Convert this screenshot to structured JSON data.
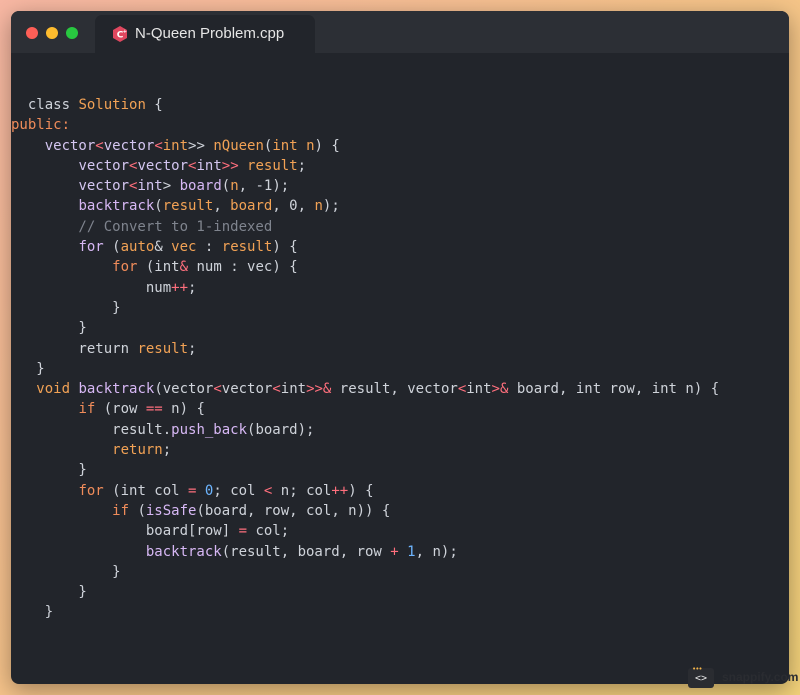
{
  "window": {
    "title": "N-Queen Problem.cpp",
    "language_icon": "cpp-icon"
  },
  "colors": {
    "background_gradient": [
      "#f7b7a3",
      "#f5c28a",
      "#f3d27a"
    ],
    "editor_bg": "#22252b",
    "titlebar_bg": "#2c2f35",
    "keyword": "#f08c5a",
    "function": "#d7b8f5",
    "operator": "#ff6f7d",
    "number": "#6db5ff",
    "comment": "#7f848e"
  },
  "code": {
    "lines": [
      [
        [
          "  class ",
          "plain"
        ],
        [
          "Solution",
          "var"
        ],
        [
          " {",
          "punct"
        ]
      ],
      [
        [
          "public:",
          "kw"
        ]
      ],
      [
        [
          "    ",
          "plain"
        ],
        [
          "vector",
          "type"
        ],
        [
          "<",
          "op"
        ],
        [
          "vector",
          "type"
        ],
        [
          "<",
          "op"
        ],
        [
          "int",
          "var"
        ],
        [
          ">> ",
          "plain"
        ],
        [
          "nQueen",
          "var"
        ],
        [
          "(",
          "punct"
        ],
        [
          "int",
          "var"
        ],
        [
          " n",
          "var"
        ],
        [
          ") {",
          "punct"
        ]
      ],
      [
        [
          "        ",
          "plain"
        ],
        [
          "vector",
          "type"
        ],
        [
          "<",
          "op"
        ],
        [
          "vector",
          "type"
        ],
        [
          "<",
          "op"
        ],
        [
          "int",
          "type"
        ],
        [
          ">>",
          "op"
        ],
        [
          " result",
          "var"
        ],
        [
          ";",
          "punct"
        ]
      ],
      [
        [
          "        ",
          "plain"
        ],
        [
          "vector",
          "type"
        ],
        [
          "<",
          "op"
        ],
        [
          "int",
          "type"
        ],
        [
          "> ",
          "plain"
        ],
        [
          "board",
          "fn"
        ],
        [
          "(",
          "punct"
        ],
        [
          "n",
          "var"
        ],
        [
          ", -1);",
          "punct"
        ]
      ],
      [
        [
          "        ",
          "plain"
        ],
        [
          "backtrack",
          "fn"
        ],
        [
          "(",
          "punct"
        ],
        [
          "result",
          "var"
        ],
        [
          ", ",
          "punct"
        ],
        [
          "board",
          "var"
        ],
        [
          ", 0, ",
          "punct"
        ],
        [
          "n",
          "var"
        ],
        [
          ");",
          "punct"
        ]
      ],
      [
        [
          "        // Convert to 1-indexed",
          "comment"
        ]
      ],
      [
        [
          "        ",
          "plain"
        ],
        [
          "for",
          "fn"
        ],
        [
          " (",
          "punct"
        ],
        [
          "auto",
          "var"
        ],
        [
          "& ",
          "plain"
        ],
        [
          "vec",
          "var"
        ],
        [
          " : ",
          "plain"
        ],
        [
          "result",
          "var"
        ],
        [
          ") {",
          "punct"
        ]
      ],
      [
        [
          "            ",
          "plain"
        ],
        [
          "for",
          "kw"
        ],
        [
          " (int",
          "plain"
        ],
        [
          "&",
          "op"
        ],
        [
          " num : vec) {",
          "plain"
        ]
      ],
      [
        [
          "                num",
          "plain"
        ],
        [
          "++",
          "op"
        ],
        [
          ";",
          "punct"
        ]
      ],
      [
        [
          "            }",
          "punct"
        ]
      ],
      [
        [
          "        }",
          "punct"
        ]
      ],
      [
        [
          "        return ",
          "plain"
        ],
        [
          "result",
          "var"
        ],
        [
          ";",
          "punct"
        ]
      ],
      [
        [
          "   }",
          "punct"
        ]
      ],
      [
        [
          "   ",
          "plain"
        ],
        [
          "void",
          "var"
        ],
        [
          " ",
          "plain"
        ],
        [
          "backtrack",
          "fn"
        ],
        [
          "(vector",
          "plain"
        ],
        [
          "<",
          "op"
        ],
        [
          "vector",
          "plain"
        ],
        [
          "<",
          "op"
        ],
        [
          "int",
          "plain"
        ],
        [
          ">>&",
          "op"
        ],
        [
          " result, vector",
          "plain"
        ],
        [
          "<",
          "op"
        ],
        [
          "int",
          "plain"
        ],
        [
          ">&",
          "op"
        ],
        [
          " board, int row, int n) {",
          "plain"
        ]
      ],
      [
        [
          "        ",
          "plain"
        ],
        [
          "if",
          "kw"
        ],
        [
          " (row ",
          "plain"
        ],
        [
          "==",
          "op"
        ],
        [
          " n) {",
          "plain"
        ]
      ],
      [
        [
          "            result.",
          "plain"
        ],
        [
          "push_back",
          "fn"
        ],
        [
          "(board);",
          "plain"
        ]
      ],
      [
        [
          "            ",
          "plain"
        ],
        [
          "return",
          "var"
        ],
        [
          ";",
          "punct"
        ]
      ],
      [
        [
          "        }",
          "punct"
        ]
      ],
      [
        [
          "        ",
          "plain"
        ],
        [
          "for",
          "kw"
        ],
        [
          " (int col ",
          "plain"
        ],
        [
          "=",
          "op"
        ],
        [
          " ",
          "plain"
        ],
        [
          "0",
          "num"
        ],
        [
          "; col ",
          "plain"
        ],
        [
          "<",
          "op"
        ],
        [
          " n; col",
          "plain"
        ],
        [
          "++",
          "op"
        ],
        [
          ") {",
          "plain"
        ]
      ],
      [
        [
          "            ",
          "plain"
        ],
        [
          "if",
          "kw"
        ],
        [
          " (",
          "plain"
        ],
        [
          "isSafe",
          "fn"
        ],
        [
          "(board, row, col, n)) {",
          "plain"
        ]
      ],
      [
        [
          "                board[row] ",
          "plain"
        ],
        [
          "=",
          "op"
        ],
        [
          " col;",
          "plain"
        ]
      ],
      [
        [
          "                ",
          "plain"
        ],
        [
          "backtrack",
          "fn"
        ],
        [
          "(result, board, row ",
          "plain"
        ],
        [
          "+",
          "op"
        ],
        [
          " ",
          "plain"
        ],
        [
          "1",
          "num"
        ],
        [
          ", n);",
          "plain"
        ]
      ],
      [
        [
          "            }",
          "punct"
        ]
      ],
      [
        [
          "        }",
          "punct"
        ]
      ],
      [
        [
          "    }",
          "punct"
        ]
      ]
    ]
  },
  "branding": {
    "text": "snappify.com",
    "icon_label": "<>"
  }
}
